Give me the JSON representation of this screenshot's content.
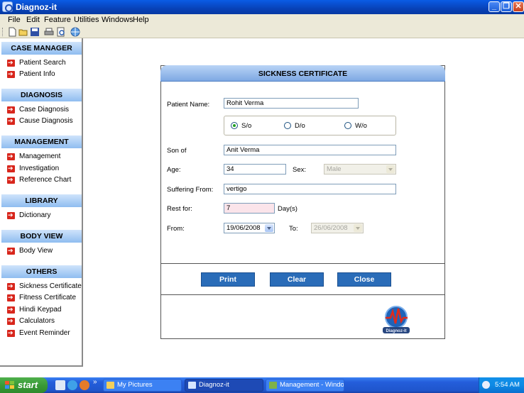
{
  "window": {
    "title": "Diagnoz-it"
  },
  "menu": [
    "File",
    "Edit",
    "Feature",
    "Utilities",
    "Windows",
    "Help"
  ],
  "toolbar": {
    "icons": [
      "new-file-icon",
      "open-folder-icon",
      "save-icon",
      "print-icon",
      "print-preview-icon",
      "globe-icon"
    ]
  },
  "sidebar": {
    "sections": [
      {
        "title": "CASE MANAGER",
        "items": [
          "Patient Search",
          "Patient Info"
        ]
      },
      {
        "title": "DIAGNOSIS",
        "items": [
          "Case Diagnosis",
          "Cause Diagnosis"
        ]
      },
      {
        "title": "MANAGEMENT",
        "items": [
          "Management",
          "Investigation",
          "Reference Chart"
        ]
      },
      {
        "title": "LIBRARY",
        "items": [
          "Dictionary"
        ]
      },
      {
        "title": "BODY VIEW",
        "items": [
          "Body View"
        ]
      },
      {
        "title": "OTHERS",
        "items": [
          "Sickness Certificate",
          "Fitness Certificate",
          "Hindi Keypad",
          "Calculators",
          "Event Reminder"
        ]
      }
    ]
  },
  "dialog": {
    "title": "SICKNESS CERTIFICATE",
    "patient_name_label": "Patient Name:",
    "patient_name": "Rohit Verma",
    "relation_options": [
      "S/o",
      "D/o",
      "W/o"
    ],
    "relation_selected": "S/o",
    "son_of_label": "Son of",
    "son_of": "Anit Verma",
    "age_label": "Age:",
    "age": "34",
    "sex_label": "Sex:",
    "sex": "Male",
    "suffering_from_label": "Suffering From:",
    "suffering_from": "vertigo",
    "rest_for_label": "Rest for:",
    "rest_for": "7",
    "days_label": "Day(s)",
    "from_label": "From:",
    "from_date": "19/06/2008",
    "to_label": "To:",
    "to_date": "26/06/2008",
    "buttons": {
      "print": "Print",
      "clear": "Clear",
      "close": "Close"
    },
    "logo_text": "Diagnoz-it"
  },
  "taskbar": {
    "start_label": "start",
    "overflow": "»",
    "tasks": [
      "My Pictures",
      "Diagnoz-it",
      "Management - Windo..."
    ],
    "active_task": "Diagnoz-it",
    "clock": "5:54 AM"
  }
}
